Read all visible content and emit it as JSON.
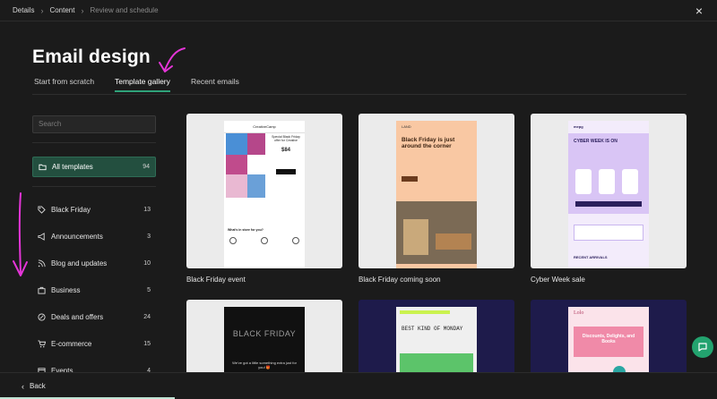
{
  "breadcrumb": {
    "step1": "Details",
    "step2": "Content",
    "step3": "Review and schedule"
  },
  "close_icon": "×",
  "title": "Email design",
  "tabs": [
    {
      "label": "Start from scratch"
    },
    {
      "label": "Template gallery"
    },
    {
      "label": "Recent emails"
    }
  ],
  "sidebar": {
    "search_placeholder": "Search",
    "all_templates": {
      "label": "All templates",
      "count": "94"
    },
    "items": [
      {
        "label": "Black Friday",
        "count": "13",
        "icon": "tag-icon"
      },
      {
        "label": "Announcements",
        "count": "3",
        "icon": "megaphone-icon"
      },
      {
        "label": "Blog and updates",
        "count": "10",
        "icon": "rss-icon"
      },
      {
        "label": "Business",
        "count": "5",
        "icon": "briefcase-icon"
      },
      {
        "label": "Deals and offers",
        "count": "24",
        "icon": "percent-icon"
      },
      {
        "label": "E-commerce",
        "count": "15",
        "icon": "cart-icon"
      },
      {
        "label": "Events",
        "count": "4",
        "icon": "calendar-icon"
      }
    ]
  },
  "cards": [
    {
      "title": "Black Friday event",
      "preview": {
        "brand": "CreativeCamp",
        "offer": "Special Black Friday offer for Creative",
        "price": "$84",
        "bottom_heading": "What's in store for you?"
      }
    },
    {
      "title": "Black Friday coming soon",
      "preview": {
        "brand": "LAND",
        "heading": "Black Friday is just around the corner"
      }
    },
    {
      "title": "Cyber Week sale",
      "preview": {
        "brand": "mepg",
        "heading": "CYBER WEEK IS ON",
        "footer": "RECENT ARRIVALS"
      }
    },
    {
      "title": "",
      "preview": {
        "heading": "BLACK FRIDAY",
        "sub": "We've got a little something extra just for you! 🎁"
      }
    },
    {
      "title": "",
      "preview": {
        "heading": "BEST KIND OF MONDAY"
      }
    },
    {
      "title": "",
      "preview": {
        "brand": "Lolo",
        "heading": "Discounts, Delights, and Books"
      }
    }
  ],
  "bottom": {
    "back_label": "Back"
  },
  "colors": {
    "accent": "#2fa37a",
    "active_bg": "#234f3f",
    "annotation": "#e535d8",
    "chat": "#23a36f"
  }
}
